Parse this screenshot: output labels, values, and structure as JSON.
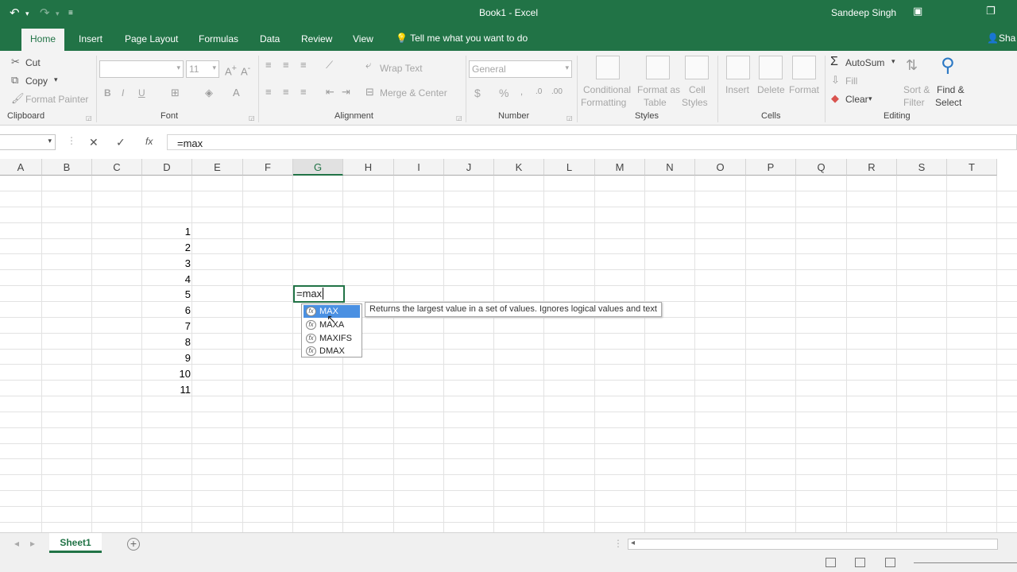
{
  "window": {
    "title": "Book1 - Excel",
    "user": "Sandeep Singh"
  },
  "tabs": [
    {
      "label": "Home"
    },
    {
      "label": "Insert"
    },
    {
      "label": "Page Layout"
    },
    {
      "label": "Formulas"
    },
    {
      "label": "Data"
    },
    {
      "label": "Review"
    },
    {
      "label": "View"
    }
  ],
  "tell_me": "Tell me what you want to do",
  "share_label": "Sha",
  "clipboard": {
    "cut": "Cut",
    "copy": "Copy",
    "format_painter": "Format Painter",
    "group": "Clipboard"
  },
  "font": {
    "size": "11",
    "bold": "B",
    "italic": "I",
    "underline": "U",
    "group": "Font"
  },
  "alignment": {
    "wrap_text": "Wrap Text",
    "merge_center": "Merge & Center",
    "group": "Alignment"
  },
  "number": {
    "format": "General",
    "currency": "$",
    "percent": "%",
    "group": "Number"
  },
  "styles": {
    "cond_1": "Conditional",
    "cond_2": "Formatting",
    "fmt_table_1": "Format as",
    "fmt_table_2": "Table",
    "cell_styles_1": "Cell",
    "cell_styles_2": "Styles",
    "group": "Styles"
  },
  "cells": {
    "insert": "Insert",
    "delete": "Delete",
    "format": "Format",
    "group": "Cells"
  },
  "editing": {
    "autosum": "AutoSum",
    "fill": "Fill",
    "clear": "Clear",
    "sort_1": "Sort &",
    "sort_2": "Filter",
    "find_1": "Find &",
    "find_2": "Select",
    "group": "Editing"
  },
  "formula_bar": {
    "cancel": "✕",
    "enter": "✓",
    "fx": "fx",
    "value": "=max"
  },
  "columns": [
    "A",
    "B",
    "C",
    "D",
    "E",
    "F",
    "G",
    "H",
    "I",
    "J",
    "K",
    "L",
    "M",
    "N",
    "O",
    "P",
    "Q",
    "R",
    "S",
    "T"
  ],
  "selected_column": "G",
  "column_d_values": [
    "1",
    "2",
    "3",
    "4",
    "5",
    "6",
    "7",
    "8",
    "9",
    "10",
    "11"
  ],
  "active_cell": {
    "value": "=max"
  },
  "autocomplete": {
    "items": [
      "MAX",
      "MAXA",
      "MAXIFS",
      "DMAX"
    ],
    "selected_index": 0,
    "tooltip": "Returns the largest value in a set of values. Ignores logical values and text"
  },
  "sheets": [
    {
      "name": "Sheet1",
      "active": true
    }
  ],
  "colors": {
    "accent": "#217346",
    "selection": "#4a90e2"
  }
}
